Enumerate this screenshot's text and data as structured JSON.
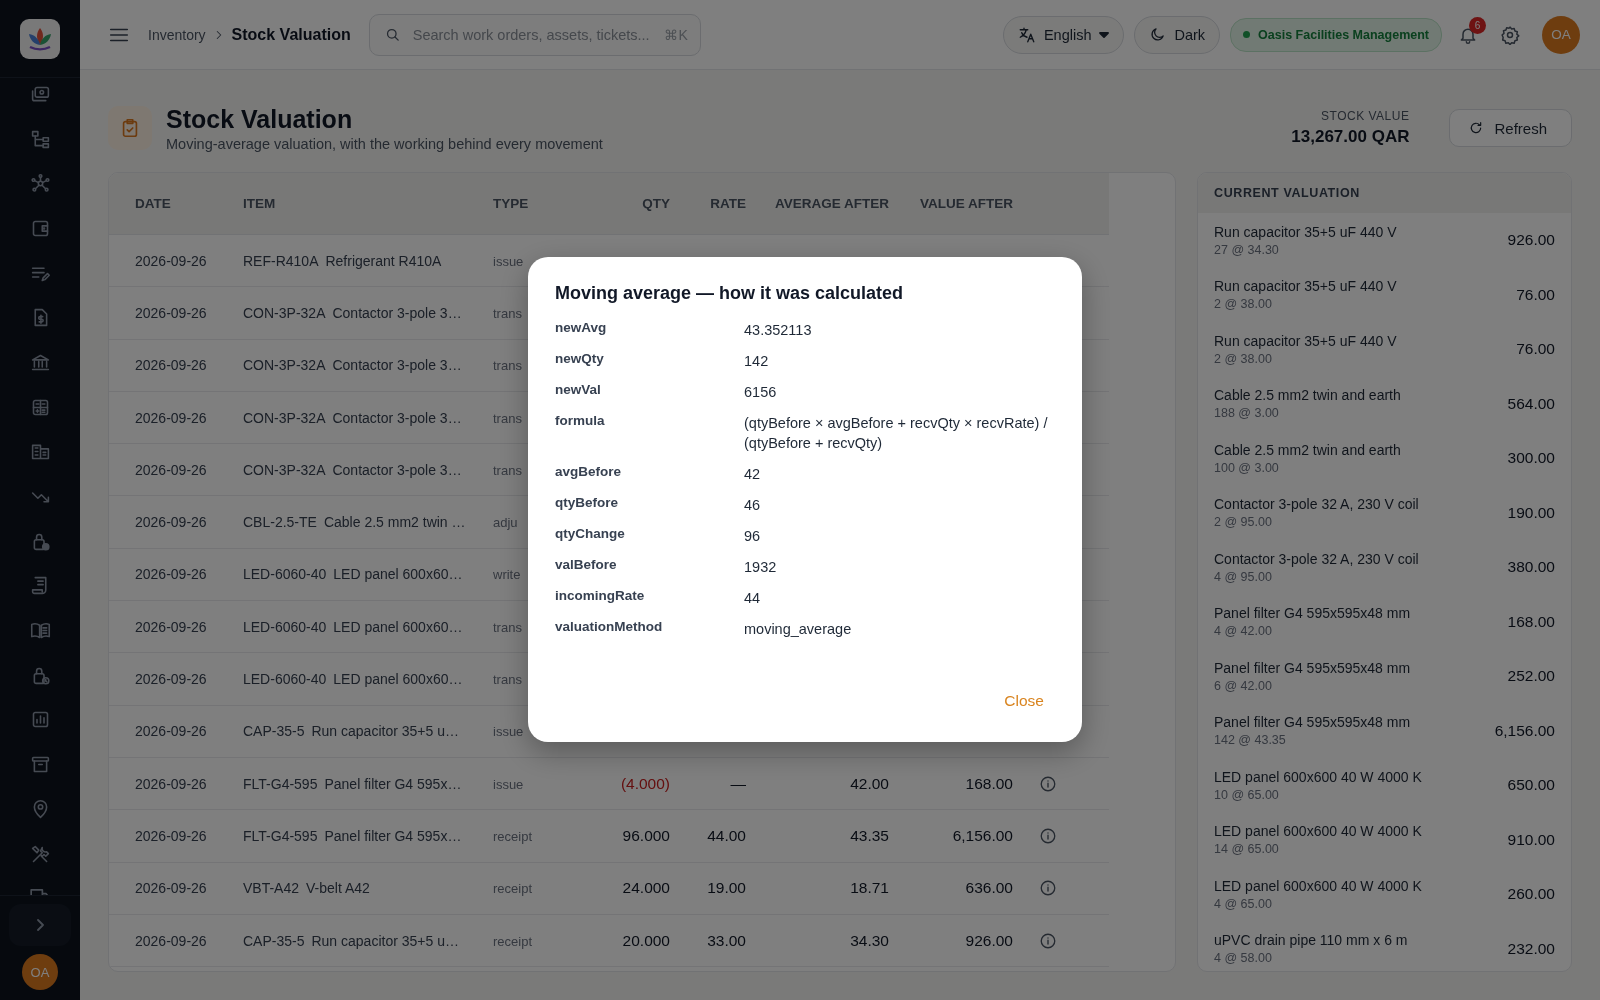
{
  "topbar": {
    "breadcrumb": [
      {
        "label": "Inventory",
        "current": false
      },
      {
        "label": "Stock Valuation",
        "current": true
      }
    ],
    "search": {
      "placeholder": "Search work orders, assets, tickets...",
      "shortcut": "⌘K"
    },
    "language": "English",
    "theme": "Dark",
    "organization": "Oasis Facilities Management",
    "notifications": "6",
    "avatar": "OA"
  },
  "sidebar": {
    "avatar": "OA"
  },
  "header": {
    "title": "Stock Valuation",
    "subtitle": "Moving-average valuation, with the working behind every movement",
    "stock_value_label": "STOCK VALUE",
    "stock_value": "13,267.00 QAR",
    "refresh": "Refresh"
  },
  "table": {
    "columns": [
      "DATE",
      "ITEM",
      "TYPE",
      "QTY",
      "RATE",
      "AVERAGE AFTER",
      "VALUE AFTER"
    ],
    "rows": [
      {
        "date": "2026-09-26",
        "code": "REF-R410A",
        "item": "Refrigerant R410A",
        "type": "issue"
      },
      {
        "date": "2026-09-26",
        "code": "CON-3P-32A",
        "item": "Contactor 3-pole 3…",
        "type": "trans"
      },
      {
        "date": "2026-09-26",
        "code": "CON-3P-32A",
        "item": "Contactor 3-pole 3…",
        "type": "trans"
      },
      {
        "date": "2026-09-26",
        "code": "CON-3P-32A",
        "item": "Contactor 3-pole 3…",
        "type": "trans"
      },
      {
        "date": "2026-09-26",
        "code": "CON-3P-32A",
        "item": "Contactor 3-pole 3…",
        "type": "trans"
      },
      {
        "date": "2026-09-26",
        "code": "CBL-2.5-TE",
        "item": "Cable 2.5 mm2 twin …",
        "type": "adju"
      },
      {
        "date": "2026-09-26",
        "code": "LED-6060-40",
        "item": "LED panel 600x60…",
        "type": "write"
      },
      {
        "date": "2026-09-26",
        "code": "LED-6060-40",
        "item": "LED panel 600x60…",
        "type": "trans"
      },
      {
        "date": "2026-09-26",
        "code": "LED-6060-40",
        "item": "LED panel 600x60…",
        "type": "trans"
      },
      {
        "date": "2026-09-26",
        "code": "CAP-35-5",
        "item": "Run capacitor 35+5 u…",
        "type": "issue"
      },
      {
        "date": "2026-09-26",
        "code": "FLT-G4-595",
        "item": "Panel filter G4 595x…",
        "type": "issue",
        "qty": "(4.000)",
        "negative": true,
        "rate": "—",
        "average_after": "42.00",
        "value_after": "168.00",
        "info": true
      },
      {
        "date": "2026-09-26",
        "code": "FLT-G4-595",
        "item": "Panel filter G4 595x…",
        "type": "receipt",
        "qty": "96.000",
        "negative": false,
        "rate": "44.00",
        "average_after": "43.35",
        "value_after": "6,156.00",
        "info": true
      },
      {
        "date": "2026-09-26",
        "code": "VBT-A42",
        "item": "V-belt A42",
        "type": "receipt",
        "qty": "24.000",
        "negative": false,
        "rate": "19.00",
        "average_after": "18.71",
        "value_after": "636.00",
        "info": true
      },
      {
        "date": "2026-09-26",
        "code": "CAP-35-5",
        "item": "Run capacitor 35+5 u…",
        "type": "receipt",
        "qty": "20.000",
        "negative": false,
        "rate": "33.00",
        "average_after": "34.30",
        "value_after": "926.00",
        "info": true
      }
    ]
  },
  "valuation": {
    "title": "CURRENT VALUATION",
    "items": [
      {
        "name": "Run capacitor 35+5 uF 440 V",
        "detail": "27 @ 34.30",
        "value": "926.00"
      },
      {
        "name": "Run capacitor 35+5 uF 440 V",
        "detail": "2 @ 38.00",
        "value": "76.00"
      },
      {
        "name": "Run capacitor 35+5 uF 440 V",
        "detail": "2 @ 38.00",
        "value": "76.00"
      },
      {
        "name": "Cable 2.5 mm2 twin and earth",
        "detail": "188 @ 3.00",
        "value": "564.00"
      },
      {
        "name": "Cable 2.5 mm2 twin and earth",
        "detail": "100 @ 3.00",
        "value": "300.00"
      },
      {
        "name": "Contactor 3-pole 32 A, 230 V coil",
        "detail": "2 @ 95.00",
        "value": "190.00"
      },
      {
        "name": "Contactor 3-pole 32 A, 230 V coil",
        "detail": "4 @ 95.00",
        "value": "380.00"
      },
      {
        "name": "Panel filter G4 595x595x48 mm",
        "detail": "4 @ 42.00",
        "value": "168.00"
      },
      {
        "name": "Panel filter G4 595x595x48 mm",
        "detail": "6 @ 42.00",
        "value": "252.00"
      },
      {
        "name": "Panel filter G4 595x595x48 mm",
        "detail": "142 @ 43.35",
        "value": "6,156.00"
      },
      {
        "name": "LED panel 600x600 40 W 4000 K",
        "detail": "10 @ 65.00",
        "value": "650.00"
      },
      {
        "name": "LED panel 600x600 40 W 4000 K",
        "detail": "14 @ 65.00",
        "value": "910.00"
      },
      {
        "name": "LED panel 600x600 40 W 4000 K",
        "detail": "4 @ 65.00",
        "value": "260.00"
      },
      {
        "name": "uPVC drain pipe 110 mm x 6 m",
        "detail": "4 @ 58.00",
        "value": "232.00"
      }
    ]
  },
  "dialog": {
    "title": "Moving average — how it was calculated",
    "fields": [
      {
        "key": "newAvg",
        "value": "43.352113"
      },
      {
        "key": "newQty",
        "value": "142"
      },
      {
        "key": "newVal",
        "value": "6156"
      },
      {
        "key": "formula",
        "value": "(qtyBefore × avgBefore + recvQty × recvRate) / (qtyBefore + recvQty)"
      },
      {
        "key": "avgBefore",
        "value": "42"
      },
      {
        "key": "qtyBefore",
        "value": "46"
      },
      {
        "key": "qtyChange",
        "value": "96"
      },
      {
        "key": "valBefore",
        "value": "1932"
      },
      {
        "key": "incomingRate",
        "value": "44"
      },
      {
        "key": "valuationMethod",
        "value": "moving_average"
      }
    ],
    "close": "Close"
  }
}
